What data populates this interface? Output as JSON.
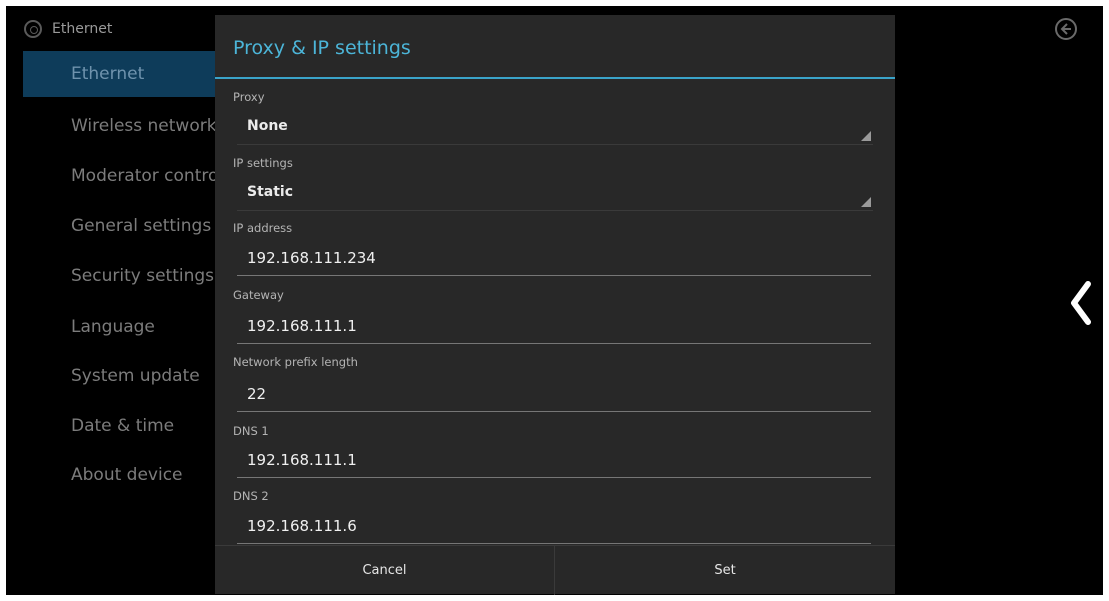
{
  "header": {
    "title": "Ethernet"
  },
  "sidebar": {
    "items": [
      {
        "label": "Ethernet",
        "active": true
      },
      {
        "label": "Wireless networks"
      },
      {
        "label": "Moderator control"
      },
      {
        "label": "General settings"
      },
      {
        "label": "Security settings"
      },
      {
        "label": "Language"
      },
      {
        "label": "System update"
      },
      {
        "label": "Date & time"
      },
      {
        "label": "About device"
      }
    ]
  },
  "dialog": {
    "title": "Proxy & IP settings",
    "proxy": {
      "label": "Proxy",
      "value": "None"
    },
    "ip_settings": {
      "label": "IP settings",
      "value": "Static"
    },
    "ip_address": {
      "label": "IP address",
      "value": "192.168.111.234"
    },
    "gateway": {
      "label": "Gateway",
      "value": "192.168.111.1"
    },
    "prefix": {
      "label": "Network prefix length",
      "value": "22"
    },
    "dns1": {
      "label": "DNS 1",
      "value": "192.168.111.1"
    },
    "dns2": {
      "label": "DNS 2",
      "value": "192.168.111.6"
    },
    "buttons": {
      "cancel": "Cancel",
      "set": "Set"
    }
  },
  "colors": {
    "accent": "#4cb5d8",
    "dialog_bg": "#282828",
    "active_item_bg": "#0e3c5a"
  },
  "icons": {
    "header": "settings-ethernet-icon",
    "top_right": "back-circle-icon",
    "right_edge": "chevron-left-icon"
  }
}
